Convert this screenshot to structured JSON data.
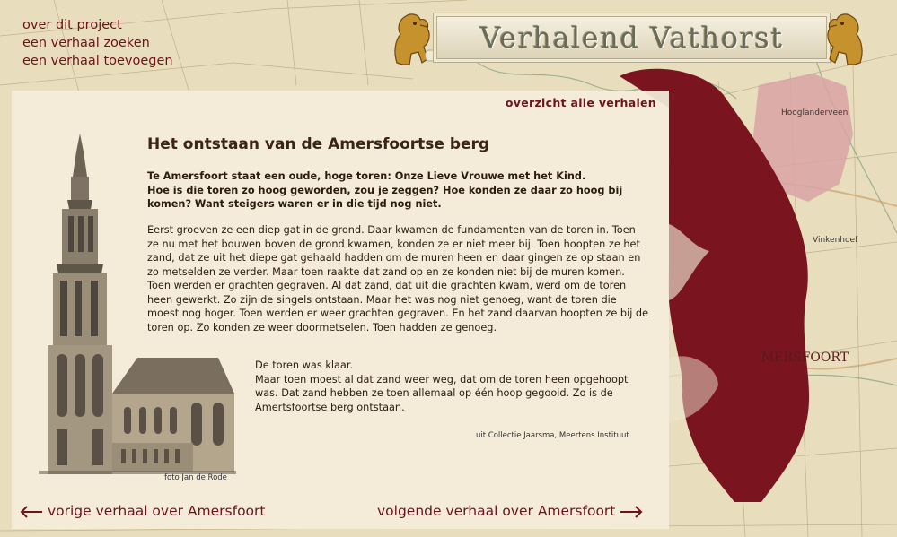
{
  "nav": {
    "items": [
      {
        "label": "over dit project"
      },
      {
        "label": "een verhaal zoeken"
      },
      {
        "label": "een verhaal toevoegen"
      }
    ]
  },
  "banner": {
    "title": "Verhalend Vathorst"
  },
  "map_labels": {
    "place_1": "Hooglanderveen",
    "place_2": "Vinkenhoef",
    "place_3": "MERSFOORT"
  },
  "panel": {
    "overview_link": "overzicht alle verhalen",
    "title": "Het ontstaan van de Amersfoortse berg",
    "intro_lines": [
      "Te Amersfoort staat een oude, hoge toren: Onze Lieve Vrouwe met het Kind.",
      "Hoe is die toren zo hoog geworden, zou je zeggen? Hoe konden ze daar zo hoog bij komen? Want steigers waren er in die tijd nog niet."
    ],
    "body": "Eerst groeven ze een diep gat in de grond. Daar kwamen de fundamenten van de toren in. Toen ze nu met het bouwen boven de grond kwamen, konden ze er niet meer bij. Toen hoopten ze het zand, dat ze uit het diepe gat gehaald hadden om de muren heen en daar gingen ze op staan en zo metselden ze verder. Maar toen raakte dat zand op en ze konden niet bij de muren komen. Toen werden er grachten gegraven. Al dat zand, dat uit die grachten kwam, werd om de toren heen gewerkt. Zo zijn de singels ontstaan. Maar het was nog niet genoeg, want de toren die moest nog hoger. Toen werden er weer grachten gegraven. En het zand daarvan hoopten ze bij de toren op. Zo konden ze weer doormetselen. Toen hadden ze genoeg.",
    "coda_lines": [
      "De toren was klaar.",
      "Maar toen moest al dat zand weer weg, dat om de toren heen opgehoopt was. Dat zand hebben ze toen allemaal op één hoop gegooid. Zo is de Amertsfoortse berg ontstaan."
    ],
    "source": "uit Collectie Jaarsma, Meertens Instituut",
    "photo_credit": "foto Jan de Rode"
  },
  "footer": {
    "prev": "vorige verhaal over Amersfoort",
    "next": "volgende verhaal over Amersfoort"
  },
  "colors": {
    "accent": "#6e1419",
    "region": "#7a1520",
    "region_light": "#d9a3a6",
    "map_bg": "#e9dfc2"
  },
  "icons": {
    "prev": "arrow-left-icon",
    "next": "arrow-right-icon",
    "banner": "lion-icon"
  }
}
